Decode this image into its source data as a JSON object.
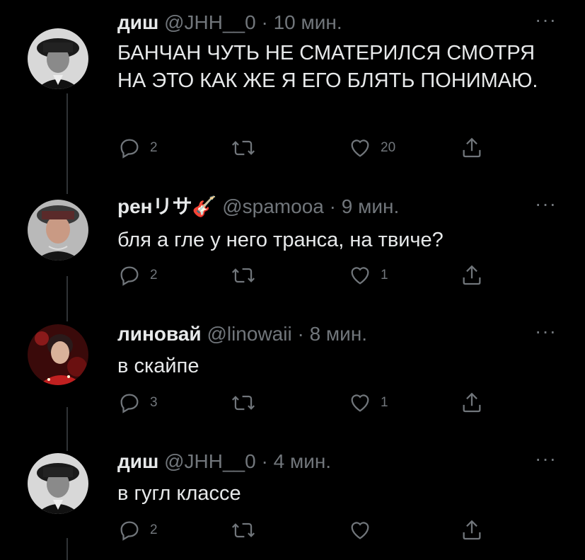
{
  "tweets": [
    {
      "name": "диш",
      "handle": "@JHH__0",
      "dot": "·",
      "time": "10 мин.",
      "text": "БАНЧАН ЧУТЬ НЕ СМАТЕРИЛСЯ СМОТРЯ НА ЭТО КАК ЖЕ Я ЕГО БЛЯТЬ ПОНИМАЮ.",
      "replies": "2",
      "retweets": "",
      "likes": "20",
      "more": "···"
    },
    {
      "name": "ренリサ🎸",
      "handle": "@spamooa",
      "dot": "·",
      "time": "9 мин.",
      "text": "бля а гле у него транса, на твиче?",
      "replies": "2",
      "retweets": "",
      "likes": "1",
      "more": "···"
    },
    {
      "name": "линовай",
      "handle": "@linowaii",
      "dot": "·",
      "time": "8 мин.",
      "text": "в скайпе",
      "replies": "3",
      "retweets": "",
      "likes": "1",
      "more": "···"
    },
    {
      "name": "диш",
      "handle": "@JHH__0",
      "dot": "·",
      "time": "4 мин.",
      "text": "в гугл классе",
      "replies": "2",
      "retweets": "",
      "likes": "",
      "more": "···"
    }
  ],
  "colors": {
    "background": "#000000",
    "text": "#e7e9ea",
    "muted": "#71767b",
    "line": "#2f3336"
  },
  "icons": [
    "reply-icon",
    "retweet-icon",
    "like-icon",
    "share-icon",
    "more-icon"
  ]
}
